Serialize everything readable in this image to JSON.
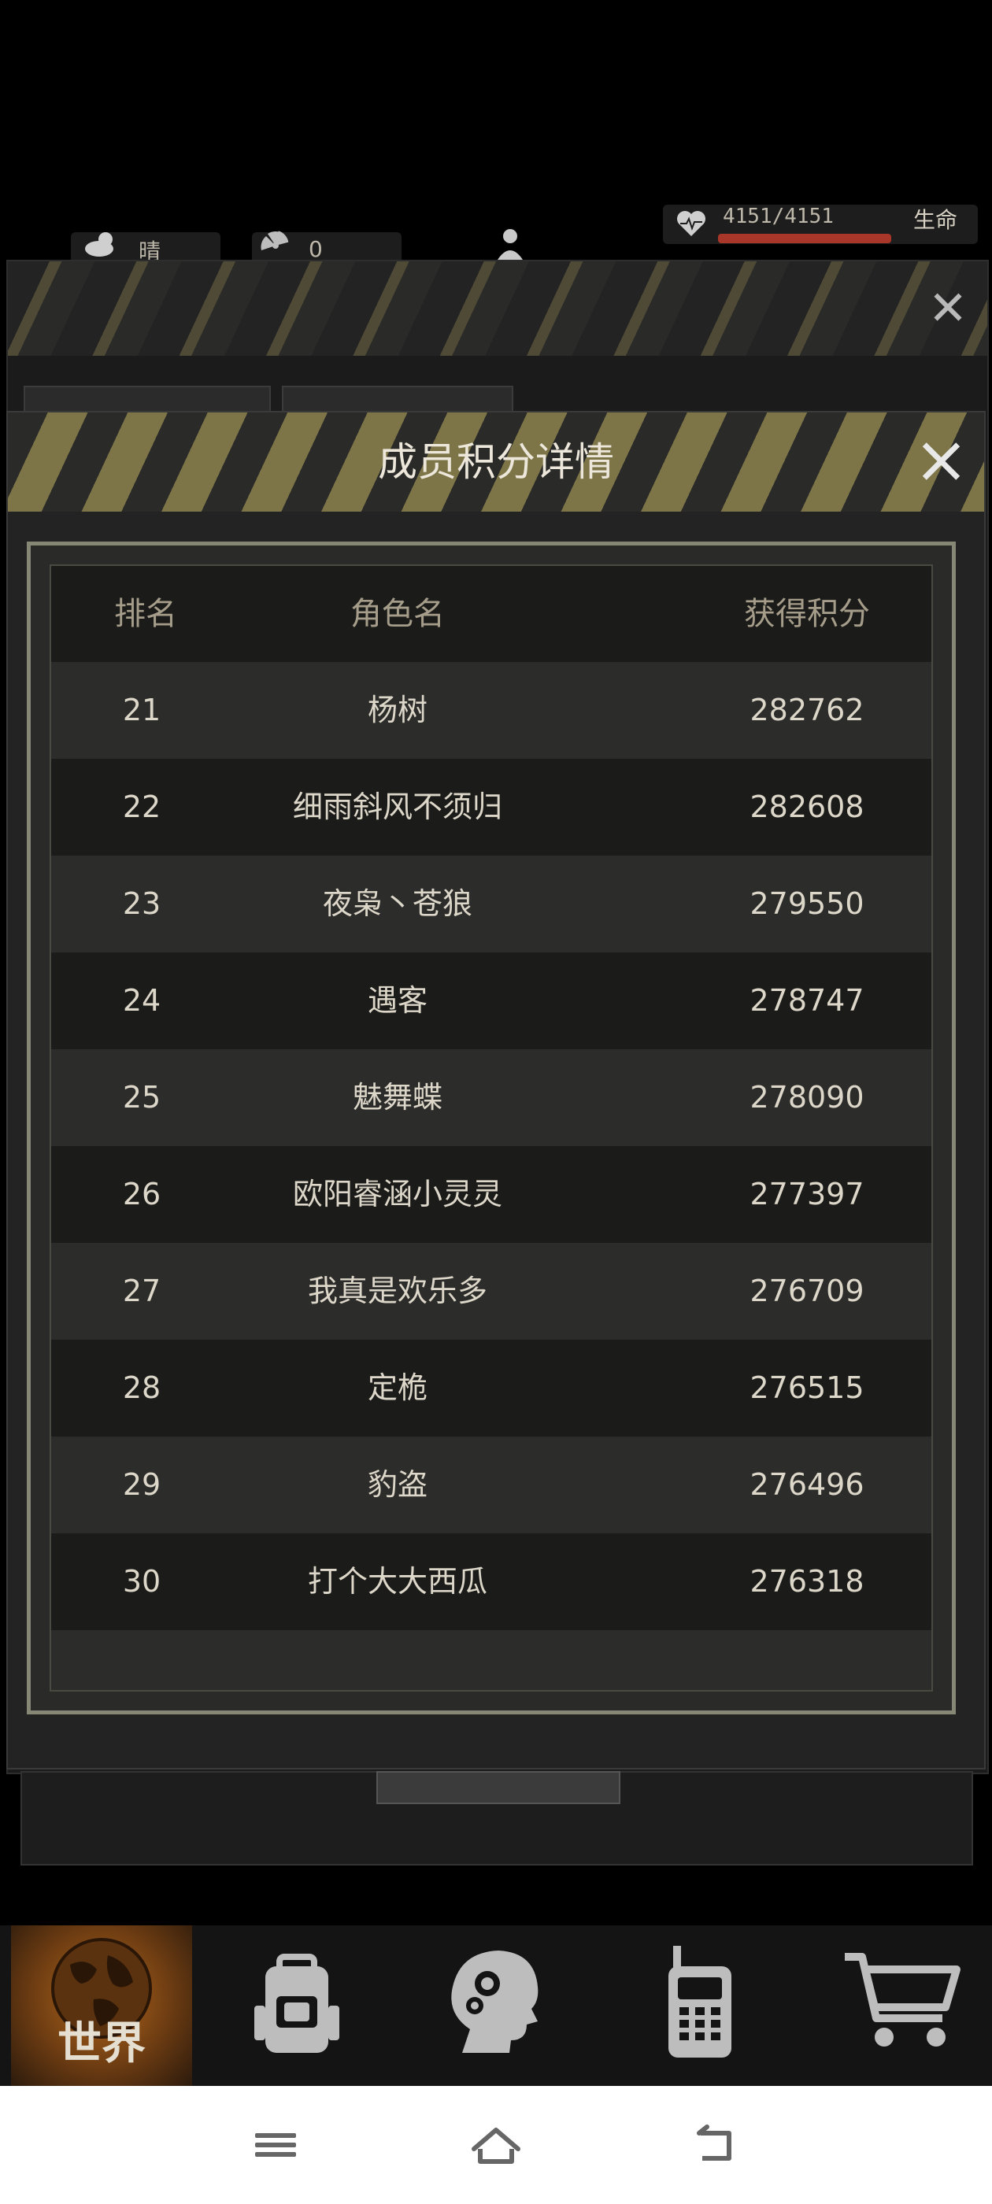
{
  "status": {
    "weather": "晴",
    "radiation": "0",
    "hp": "4151/4151",
    "hp_label": "生命"
  },
  "modal": {
    "title": "成员积分详情",
    "headers": {
      "rank": "排名",
      "name": "角色名",
      "score": "获得积分"
    },
    "rows": [
      {
        "rank": "21",
        "name": "杨树",
        "score": "282762"
      },
      {
        "rank": "22",
        "name": "细雨斜风不须归",
        "score": "282608"
      },
      {
        "rank": "23",
        "name": "夜枭丶苍狼",
        "score": "279550"
      },
      {
        "rank": "24",
        "name": "遇客",
        "score": "278747"
      },
      {
        "rank": "25",
        "name": "魅舞蝶",
        "score": "278090"
      },
      {
        "rank": "26",
        "name": "欧阳睿涵小灵灵",
        "score": "277397"
      },
      {
        "rank": "27",
        "name": "我真是欢乐多",
        "score": "276709"
      },
      {
        "rank": "28",
        "name": "定桅",
        "score": "276515"
      },
      {
        "rank": "29",
        "name": "豹盗",
        "score": "276496"
      },
      {
        "rank": "30",
        "name": "打个大大西瓜",
        "score": "276318"
      }
    ]
  },
  "bottom_nav": {
    "world_label": "世界",
    "items": [
      "globe-icon",
      "backpack-icon",
      "brain-icon",
      "radio-icon",
      "cart-icon"
    ]
  },
  "colors": {
    "accent": "#b4691c",
    "hp_bar": "#a8372a",
    "frame": "#878776"
  }
}
